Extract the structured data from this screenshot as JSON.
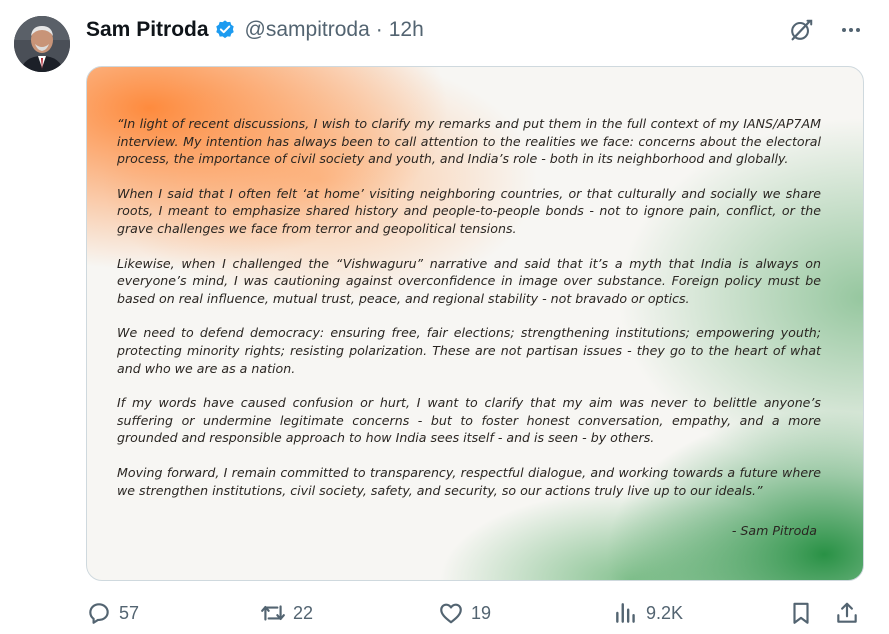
{
  "tweet": {
    "author_name": "Sam Pitroda",
    "handle": "@sampitroda",
    "separator": "·",
    "time": "12h"
  },
  "letter": {
    "paragraphs": [
      "“In light of recent discussions, I wish to clarify my remarks and put them in the full context of my IANS/AP7AM interview. My intention has always been to call attention to the realities we face: concerns about the electoral process, the importance of civil society and youth, and India’s role - both in its neighborhood and globally.",
      "When I said that I often felt ‘at home’ visiting neighboring countries, or that culturally and socially we share roots, I meant to emphasize shared history and people-to-people bonds - not to ignore pain, conflict, or the grave challenges we face from terror and geopolitical tensions.",
      "Likewise, when I challenged the “Vishwaguru” narrative and said that it’s a myth that India is always on everyone’s mind, I was cautioning against overconfidence in image over substance. Foreign policy must be based on real influence, mutual trust, peace, and regional stability - not bravado or optics.",
      "We need to defend democracy: ensuring free, fair elections; strengthening institutions; empowering youth; protecting minority rights; resisting polarization. These are not partisan issues - they go to the heart of what and who we are as a nation.",
      "If my words have caused confusion or hurt, I want to clarify that my aim was never to belittle anyone’s suffering or undermine legitimate concerns - but to foster honest conversation, empathy, and a more grounded and responsible approach to how India sees itself - and is seen - by others.",
      "Moving forward, I remain committed to transparency, respectful dialogue, and working towards a future where we strengthen institutions, civil society, safety, and security, so our actions truly live up to our ideals.”"
    ],
    "signature": "- Sam Pitroda"
  },
  "actions": {
    "replies": "57",
    "reposts": "22",
    "likes": "19",
    "views": "9.2K"
  },
  "colors": {
    "verified": "#1d9bf0",
    "secondary_text": "#536471",
    "saffron": "#ff7a1e",
    "green": "#1e8c3c"
  },
  "icons": [
    "verified-badge-icon",
    "grok-icon",
    "more-icon",
    "reply-icon",
    "repost-icon",
    "like-icon",
    "views-icon",
    "bookmark-icon",
    "share-icon"
  ]
}
